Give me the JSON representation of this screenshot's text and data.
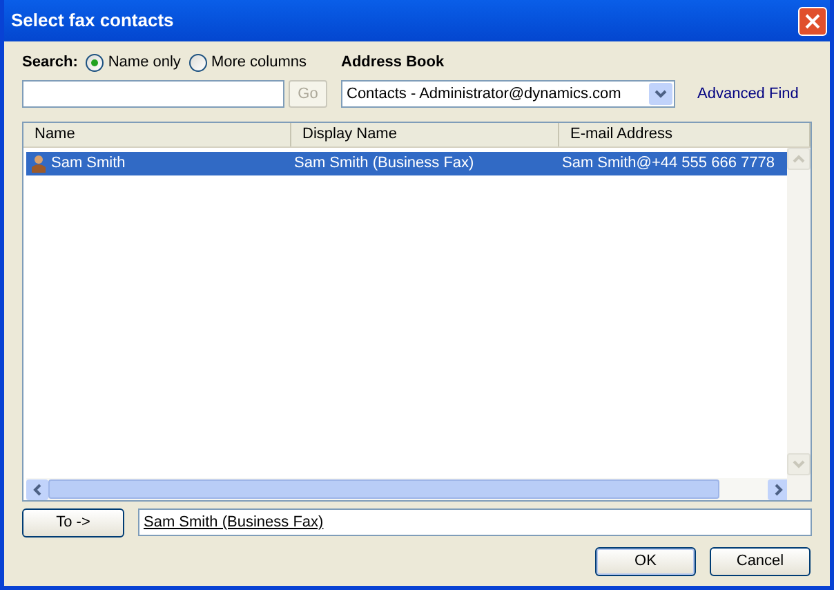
{
  "window": {
    "title": "Select fax contacts"
  },
  "search": {
    "label": "Search:",
    "options": [
      {
        "label": "Name only",
        "selected": true
      },
      {
        "label": "More columns",
        "selected": false
      }
    ],
    "go_button": {
      "label": "Go",
      "disabled": true
    }
  },
  "address_book": {
    "label": "Address Book",
    "value": "Contacts - Administrator@dynamics.com"
  },
  "advanced_find": "Advanced Find",
  "table": {
    "columns": [
      "Name",
      "Display Name",
      "E-mail Address"
    ],
    "rows": [
      {
        "cells": [
          "Sam Smith",
          "Sam Smith (Business Fax)",
          "Sam Smith@+44 555 666 7778"
        ],
        "selected": true
      }
    ]
  },
  "to_button": "To ->",
  "to_field": {
    "value": "Sam Smith (Business Fax)"
  },
  "buttons": [
    "OK",
    "Cancel"
  ]
}
